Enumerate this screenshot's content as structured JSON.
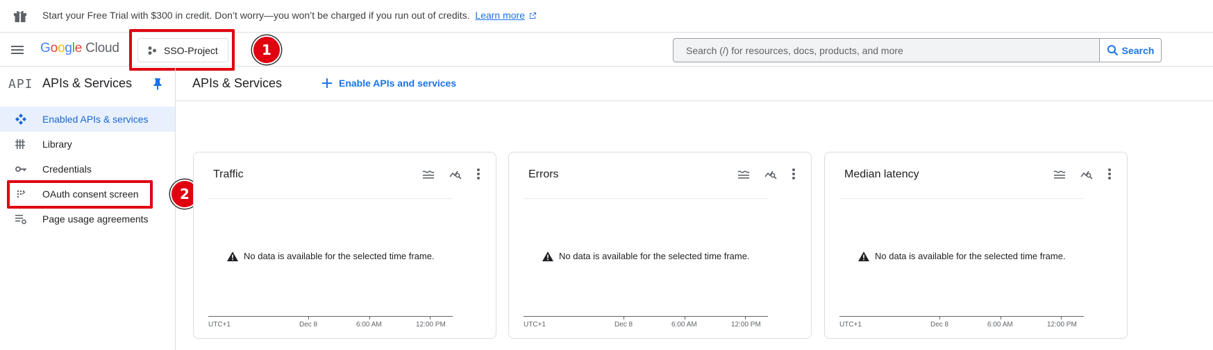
{
  "banner": {
    "text": "Start your Free Trial with $300 in credit. Don’t worry—you won’t be charged if you run out of credits.",
    "link": "Learn more"
  },
  "header": {
    "logo_letters": [
      "G",
      "o",
      "o",
      "g",
      "l",
      "e"
    ],
    "logo_product": "Cloud",
    "project": "SSO-Project",
    "search_placeholder": "Search (/) for resources, docs, products, and more",
    "search_button": "Search"
  },
  "annotations": {
    "badge1": "1",
    "badge2": "2",
    "color": "#e0000f"
  },
  "sidebar": {
    "api_icon": "API",
    "title": "APIs & Services",
    "items": [
      {
        "label": "Enabled APIs & services",
        "icon": "enabled-apis-icon",
        "active": true
      },
      {
        "label": "Library",
        "icon": "library-icon",
        "active": false
      },
      {
        "label": "Credentials",
        "icon": "key-icon",
        "active": false
      },
      {
        "label": "OAuth consent screen",
        "icon": "oauth-consent-icon",
        "active": false
      },
      {
        "label": "Page usage agreements",
        "icon": "page-usage-icon",
        "active": false
      }
    ]
  },
  "main": {
    "title": "APIs & Services",
    "enable_link": "Enable APIs and services",
    "cards": [
      {
        "title": "Traffic",
        "message": "No data is available for the selected time frame.",
        "ticks": [
          "UTC+1",
          "Dec 8",
          "6:00 AM",
          "12:00 PM"
        ]
      },
      {
        "title": "Errors",
        "message": "No data is available for the selected time frame.",
        "ticks": [
          "UTC+1",
          "Dec 8",
          "6:00 AM",
          "12:00 PM"
        ]
      },
      {
        "title": "Median latency",
        "message": "No data is available for the selected time frame.",
        "ticks": [
          "UTC+1",
          "Dec 8",
          "6:00 AM",
          "12:00 PM"
        ]
      }
    ]
  },
  "colors": {
    "accent": "#1a73e8",
    "active_bg": "#e8f0fe",
    "border": "#dadce0"
  }
}
